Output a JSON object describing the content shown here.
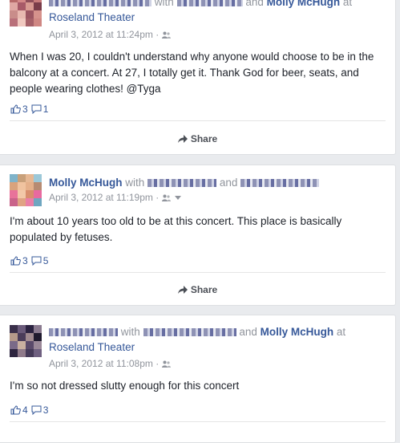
{
  "posts": [
    {
      "author": "",
      "with_label": "with",
      "and_label": "and",
      "tagged_name": "Molly McHugh",
      "at_label": "at",
      "location": "Roseland Theater",
      "timestamp": "April 3, 2012 at 11:24pm",
      "separator": "·",
      "text": "When I was 20, I couldn't understand why anyone would choose to be in the balcony at a concert. At 27, I totally get it. Thank God for beer, seats, and people wearing clothes! @Tyga",
      "likes": "3",
      "comments": "1",
      "share_label": "Share"
    },
    {
      "author": "Molly McHugh",
      "with_label": "with",
      "and_label": "and",
      "timestamp": "April 3, 2012 at 11:19pm",
      "separator": "·",
      "text": "I'm about 10 years too old to be at this concert. This place is basically populated by fetuses.",
      "likes": "3",
      "comments": "5",
      "share_label": "Share"
    },
    {
      "with_label": "with",
      "and_label": "and",
      "tagged_name": "Molly McHugh",
      "at_label": "at",
      "location": "Roseland Theater",
      "timestamp": "April 3, 2012 at 11:08pm",
      "separator": "·",
      "text": "I'm so not dressed slutty enough for this concert",
      "likes": "4",
      "comments": "3"
    }
  ],
  "colors": {
    "link": "#365899",
    "meta": "#90949c",
    "text": "#1d2129",
    "background": "#e9ebee"
  },
  "icons": [
    "like-icon",
    "comment-icon",
    "share-icon",
    "friends-icon"
  ]
}
